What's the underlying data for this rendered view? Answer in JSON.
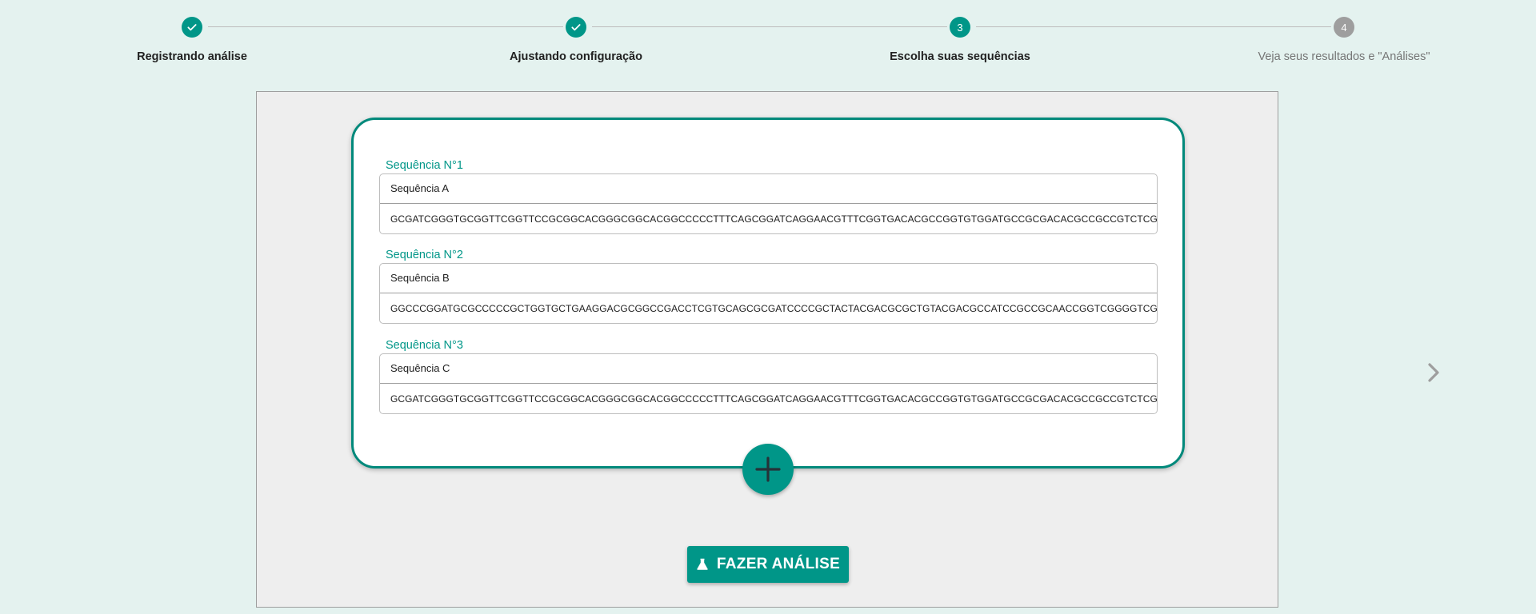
{
  "stepper": {
    "steps": [
      {
        "label": "Registrando análise",
        "state": "done",
        "icon": "check-icon"
      },
      {
        "label": "Ajustando configuração",
        "state": "done",
        "icon": "check-icon"
      },
      {
        "label": "Escolha suas sequências",
        "state": "active",
        "number": "3"
      },
      {
        "label": "Veja seus resultados e \"Análises\"",
        "state": "inactive",
        "number": "4"
      }
    ]
  },
  "sequences": [
    {
      "title": "Sequência N°1",
      "name": "Sequência A",
      "dna": "GCGATCGGGTGCGGTTCGGTTCCGCGGCACGGGCGGCACGGCCCCCTTTCAGCGGATCAGGAACGTTTCGGTGACACGCCGGTGTGGATGCCGCGACACGCCGCCGTCTCGG"
    },
    {
      "title": "Sequência N°2",
      "name": "Sequência B",
      "dna": "GGCCCGGATGCGCCCCCGCTGGTGCTGAAGGACGCGGCCGACCTCGTGCAGCGCGATCCCCGCTACTACGACGCGCTGTACGACGCCATCCGCCGCAACCGGTCGGGGTCGG"
    },
    {
      "title": "Sequência N°3",
      "name": "Sequência C",
      "dna": "GCGATCGGGTGCGGTTCGGTTCCGCGGCACGGGCGGCACGGCCCCCTTTCAGCGGATCAGGAACGTTTCGGTGACACGCCGGTGTGGATGCCGCGACACGCCGCCGTCTCGG"
    }
  ],
  "actions": {
    "add_icon": "plus-icon",
    "next_icon": "chevron-right-icon",
    "analyze_label": "FAZER ANÁLISE",
    "analyze_icon": "flask-icon"
  },
  "colors": {
    "accent": "#009688",
    "card_border": "#00897b",
    "background": "#e4f2ef",
    "panel": "#eeeeee",
    "inactive": "#9e9e9e"
  }
}
